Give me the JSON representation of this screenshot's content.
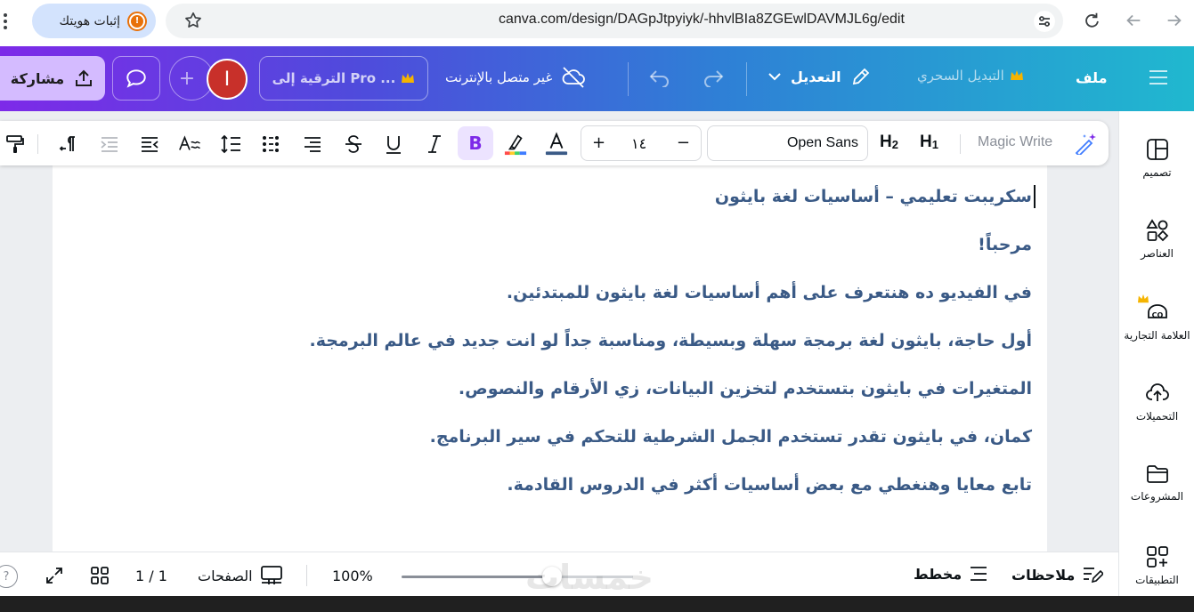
{
  "browser": {
    "identity_label": "إثبات هويتك",
    "url": "canva.com/design/DAGpJtpyiyk/-hhvlBIa8ZGEwlDAVMJL6g/edit"
  },
  "header": {
    "share_label": "مشاركة",
    "avatar_initial": "I",
    "upgrade_label": "الترقية إلى Pro ...",
    "offline_label": "غير متصل بالإنترنت",
    "edit_label": "التعديل",
    "magic_switch_label": "التبديل السحري",
    "file_label": "ملف"
  },
  "toolbar": {
    "font_size": "١٤",
    "font_family": "Open Sans",
    "h2": "H",
    "h2_sub": "2",
    "h1": "H",
    "h1_sub": "1",
    "magic_write": "Magic Write",
    "bold": "B"
  },
  "document": {
    "lines": [
      "سكريبت تعليمي – أساسيات لغة بايثون",
      "مرحباً!",
      "في الفيديو ده هنتعرف على أهم أساسيات لغة بايثون للمبتدئين.",
      "أول حاجة، بايثون لغة برمجة سهلة وبسيطة، ومناسبة جداً لو انت جديد في عالم البرمجة.",
      "المتغيرات في بايثون بتستخدم لتخزين البيانات، زي الأرقام والنصوص.",
      "كمان، في بايثون تقدر تستخدم الجمل الشرطية للتحكم في سير البرنامج.",
      "تابع معايا وهنغطي مع بعض أساسيات أكثر في الدروس القادمة."
    ]
  },
  "sidebar": {
    "items": [
      {
        "label": "تصميم",
        "icon": "design-icon"
      },
      {
        "label": "العناصر",
        "icon": "elements-icon"
      },
      {
        "label": "العلامة التجارية",
        "icon": "brand-icon"
      },
      {
        "label": "التحميلات",
        "icon": "uploads-icon"
      },
      {
        "label": "المشروعات",
        "icon": "projects-icon"
      },
      {
        "label": "التطبيقات",
        "icon": "apps-icon"
      }
    ]
  },
  "bottombar": {
    "page_count": "1 / 1",
    "pages_label": "الصفحات",
    "zoom": "100%",
    "zoom_fraction": 0.65,
    "outline_label": "مخطط",
    "notes_label": "ملاحظات",
    "help": "?",
    "watermark": "خمسات"
  },
  "colors": {
    "accent": "#7d2ae8",
    "text_blue": "#3a5a86",
    "share_bg": "#d4bbff"
  }
}
